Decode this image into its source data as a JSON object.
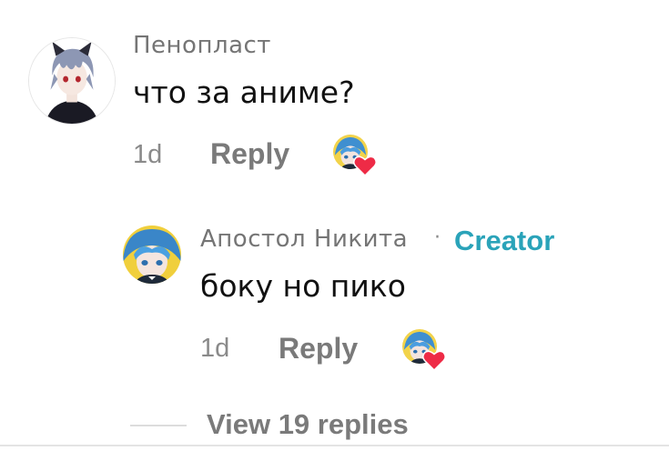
{
  "comments": [
    {
      "username": "Пенопласт",
      "text": "что за аниме?",
      "time": "1d",
      "reply_label": "Reply",
      "avatar_icon": "anime-boy-avatar",
      "creator_liked_icon": "creator-avatar-heart-icon"
    }
  ],
  "reply": {
    "username": "Апостол Никита",
    "separator": "·",
    "creator_label": "Creator",
    "text": "боку но пико",
    "time": "1d",
    "reply_label": "Reply",
    "avatar_icon": "anime-avatar-blue-hair",
    "creator_liked_icon": "creator-avatar-heart-icon"
  },
  "view_replies_label": "View 19 replies",
  "colors": {
    "creator_accent": "#2aa3b9",
    "heart": "#ee2b46",
    "muted_text": "#757575"
  }
}
